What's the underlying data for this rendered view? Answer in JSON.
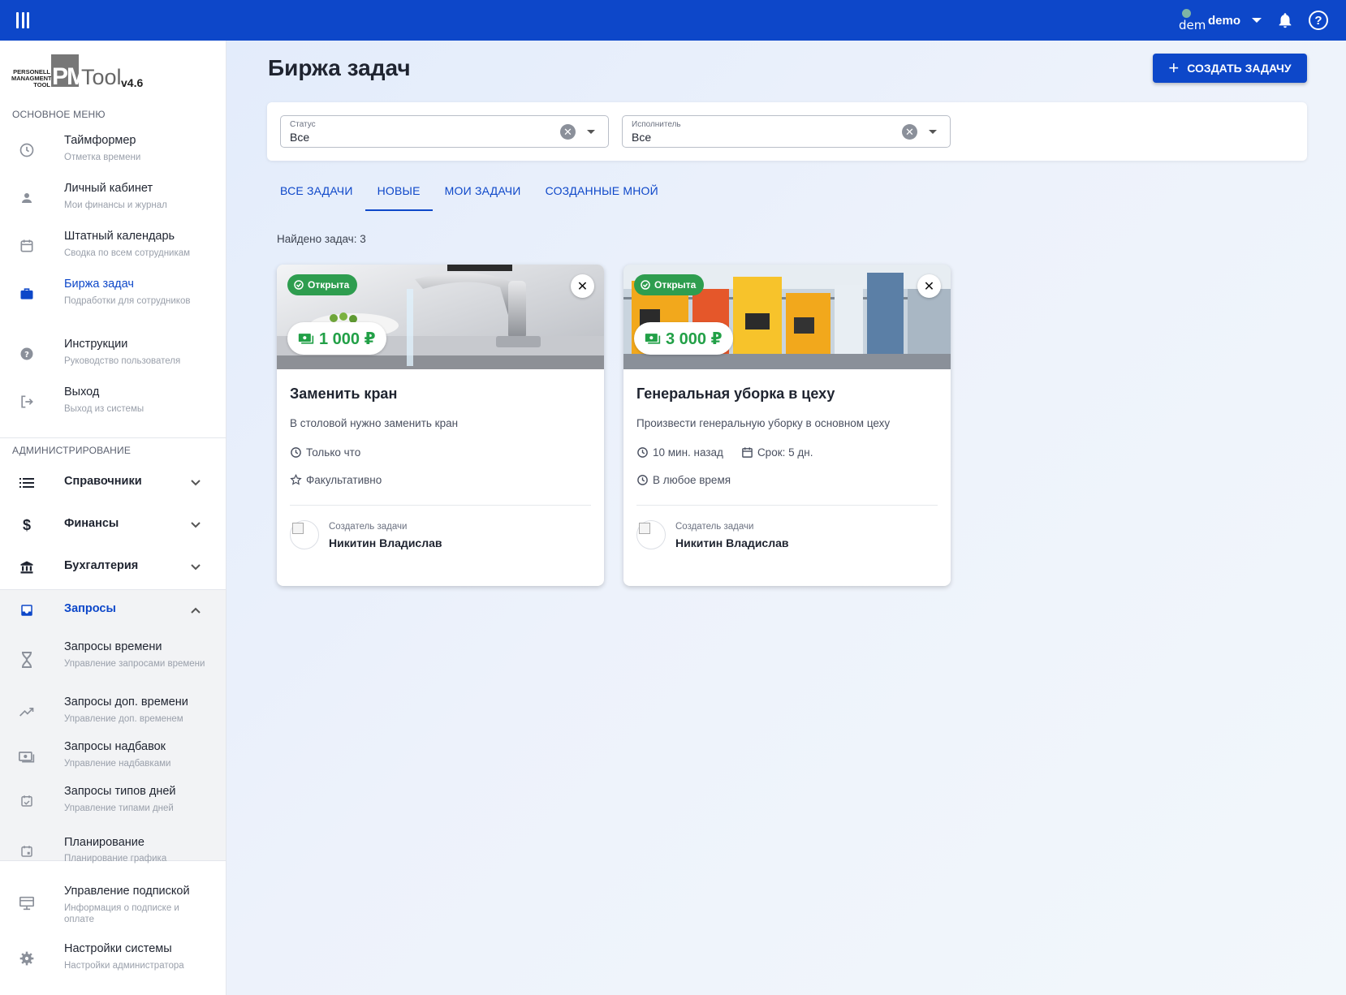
{
  "app": {
    "user_avatar_text": "dem",
    "user_name": "demo",
    "logo": {
      "line1": "PERSONELL",
      "line2": "MANAGMENT",
      "line3": "TOOL",
      "pm": "PM",
      "tool": "Tool",
      "version": "v4.6"
    }
  },
  "sidebar": {
    "main_menu_title": "ОСНОВНОЕ МЕНЮ",
    "main_items": [
      {
        "label": "Таймформер",
        "sub": "Отметка времени",
        "icon": "clock-icon"
      },
      {
        "label": "Личный кабинет",
        "sub": "Мои финансы и журнал",
        "icon": "person-icon"
      },
      {
        "label": "Штатный календарь",
        "sub": "Сводка по всем сотрудникам",
        "icon": "calendar-icon"
      },
      {
        "label": "Биржа задач",
        "sub": "Подработки для сотрудников",
        "icon": "briefcase-icon"
      },
      {
        "label": "Инструкции",
        "sub": "Руководство пользователя",
        "icon": "help-circle-icon"
      },
      {
        "label": "Выход",
        "sub": "Выход из системы",
        "icon": "logout-icon"
      }
    ],
    "admin_title": "АДМИНИСТРИРОВАНИЕ",
    "groups": [
      {
        "label": "Справочники",
        "icon": "list-icon"
      },
      {
        "label": "Финансы",
        "icon": "dollar-icon"
      },
      {
        "label": "Бухгалтерия",
        "icon": "bank-icon"
      },
      {
        "label": "Запросы",
        "icon": "inbox-icon"
      }
    ],
    "request_items": [
      {
        "label": "Запросы времени",
        "sub": "Управление запросами времени",
        "icon": "hourglass-icon"
      },
      {
        "label": "Запросы доп. времени",
        "sub": "Управление доп. временем",
        "icon": "trending-up-icon"
      },
      {
        "label": "Запросы надбавок",
        "sub": "Управление надбавками",
        "icon": "money-icon"
      },
      {
        "label": "Запросы типов дней",
        "sub": "Управление типами дней",
        "icon": "event-check-icon"
      }
    ],
    "other_items": [
      {
        "label": "Планирование",
        "sub": "Планирование графика",
        "icon": "event-icon"
      },
      {
        "label": "Управление подпиской",
        "sub": "Информация о подписке и оплате",
        "icon": "subscription-icon"
      },
      {
        "label": "Настройки системы",
        "sub": "Настройки администратора",
        "icon": "gear-icon"
      }
    ]
  },
  "main": {
    "title": "Биржа задач",
    "create_button": "СОЗДАТЬ ЗАДАЧУ",
    "filters": {
      "status_label": "Статус",
      "status_value": "Все",
      "assignee_label": "Исполнитель",
      "assignee_value": "Все"
    },
    "tabs": [
      "ВСЕ ЗАДАЧИ",
      "НОВЫЕ",
      "МОИ ЗАДАЧИ",
      "СОЗДАННЫЕ МНОЙ"
    ],
    "active_tab": "НОВЫЕ",
    "found_text": "Найдено задач: 3",
    "cards": [
      {
        "status": "Открыта",
        "price": "1 000 ₽",
        "title": "Заменить кран",
        "description": "В столовой нужно заменить кран",
        "time": "Только что",
        "extra": "Факультативно",
        "creator_label": "Создатель задачи",
        "creator_name": "Никитин Владислав"
      },
      {
        "status": "Открыта",
        "price": "3 000 ₽",
        "title": "Генеральная уборка в цеху",
        "description": "Произвести генеральную уборку в основном цеху",
        "time": "10 мин. назад",
        "deadline": "Срок: 5 дн.",
        "extra": "В любое время",
        "creator_label": "Создатель задачи",
        "creator_name": "Никитин Владислав"
      }
    ]
  },
  "colors": {
    "primary": "#0d47c9",
    "success": "#2e9d4f"
  }
}
